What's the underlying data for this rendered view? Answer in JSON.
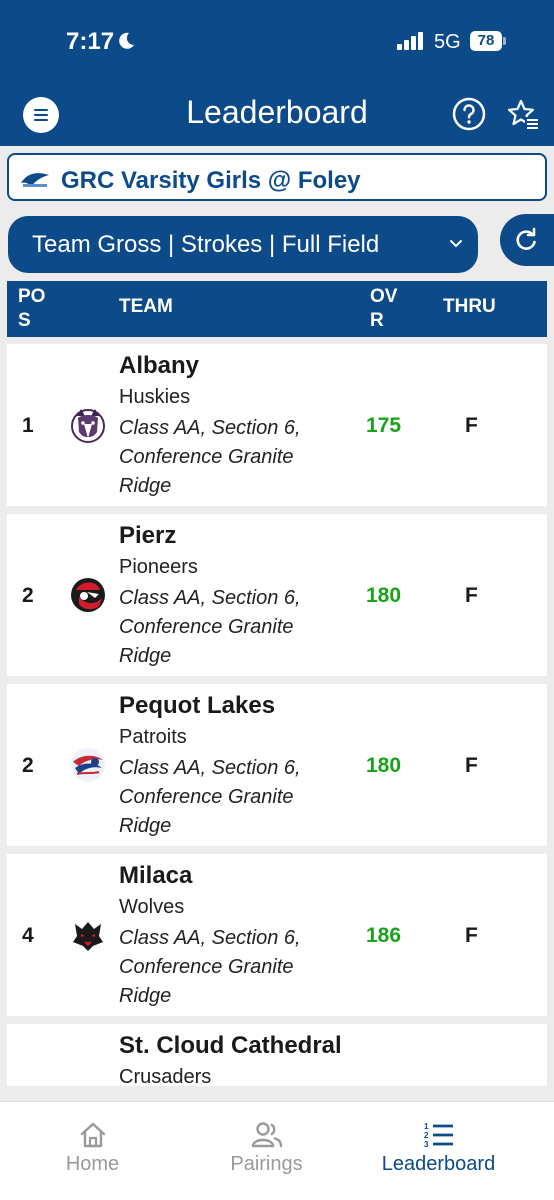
{
  "status_bar": {
    "time": "7:17",
    "network": "5G",
    "battery": "78"
  },
  "header": {
    "title": "Leaderboard"
  },
  "event": {
    "title": "GRC Varsity Girls @ Foley"
  },
  "filter": {
    "label": "Team Gross | Strokes | Full Field"
  },
  "table": {
    "headers": {
      "pos": "POS",
      "team": "TEAM",
      "ovr": "OVR",
      "thru": "THRU"
    },
    "rows": [
      {
        "pos": "1",
        "team": "Albany",
        "mascot": "Huskies",
        "details": "Class AA, Section 6, Conference Granite Ridge",
        "score": "175",
        "thru": "F",
        "logo_icon": "husky-logo-icon"
      },
      {
        "pos": "2",
        "team": "Pierz",
        "mascot": "Pioneers",
        "details": "Class AA, Section 6, Conference Granite Ridge",
        "score": "180",
        "thru": "F",
        "logo_icon": "pioneer-logo-icon"
      },
      {
        "pos": "2",
        "team": "Pequot Lakes",
        "mascot": "Patroits",
        "details": "Class AA, Section 6, Conference Granite Ridge",
        "score": "180",
        "thru": "F",
        "logo_icon": "patriot-logo-icon"
      },
      {
        "pos": "4",
        "team": "Milaca",
        "mascot": "Wolves",
        "details": "Class AA, Section 6, Conference Granite Ridge",
        "score": "186",
        "thru": "F",
        "logo_icon": "wolf-logo-icon"
      },
      {
        "pos": "",
        "team": "St. Cloud Cathedral",
        "mascot": "Crusaders",
        "details": "",
        "score": "",
        "thru": ""
      }
    ]
  },
  "nav": {
    "items": [
      {
        "label": "Home",
        "icon": "home-icon",
        "active": false
      },
      {
        "label": "Pairings",
        "icon": "people-icon",
        "active": false
      },
      {
        "label": "Leaderboard",
        "icon": "leaderboard-list-icon",
        "active": true
      }
    ]
  },
  "colors": {
    "primary": "#0c4a8a",
    "score": "#1aa31a",
    "inactive": "#9a9a9a"
  }
}
